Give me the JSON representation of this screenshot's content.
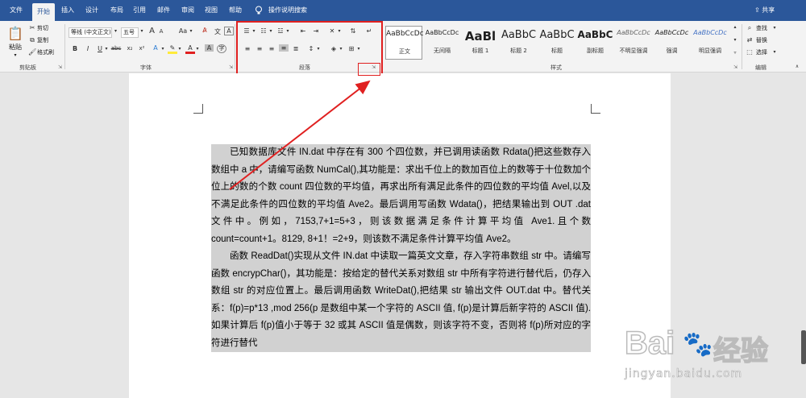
{
  "tabs": [
    "文件",
    "开始",
    "插入",
    "设计",
    "布局",
    "引用",
    "邮件",
    "审阅",
    "视图",
    "帮助"
  ],
  "active_tab": "开始",
  "tell_me": "操作说明搜索",
  "share": "共享",
  "clipboard": {
    "paste": "粘贴",
    "cut": "剪切",
    "copy": "复制",
    "format_painter": "格式刷",
    "group": "剪贴板"
  },
  "font": {
    "name": "等线 (中文正文)",
    "size": "五号",
    "group": "字体",
    "grow": "A",
    "shrink": "A",
    "case": "Aa",
    "bold": "B",
    "italic": "I",
    "underline": "U",
    "strike": "abc",
    "sub": "x₂",
    "sup": "x²"
  },
  "paragraph": {
    "group": "段落"
  },
  "styles": {
    "group": "样式",
    "items": [
      {
        "preview": "AaBbCcDc",
        "name": "正文",
        "color": "#1f1f1f"
      },
      {
        "preview": "AaBbCcDc",
        "name": "无间隔",
        "color": "#1f1f1f"
      },
      {
        "preview": "AaBl",
        "name": "标题 1",
        "color": "#1f1f1f"
      },
      {
        "preview": "AaBbC",
        "name": "标题 2",
        "color": "#1f1f1f"
      },
      {
        "preview": "AaBbC",
        "name": "标题",
        "color": "#1f1f1f"
      },
      {
        "preview": "AaBbC",
        "name": "副标题",
        "color": "#1f1f1f"
      },
      {
        "preview": "AaBbCcDc",
        "name": "不明显强调",
        "color": "#666666"
      },
      {
        "preview": "AaBbCcDc",
        "name": "强调",
        "color": "#1f1f1f"
      },
      {
        "preview": "AaBbCcDc",
        "name": "明显强调",
        "color": "#4472c4"
      }
    ]
  },
  "editing": {
    "find": "查找",
    "replace": "替换",
    "select": "选择",
    "group": "编辑"
  },
  "document": {
    "paragraphs": [
      "已知数据库文件 IN.dat 中存在有 300 个四位数，并已调用读函数 Rdata()把这些数存入数组中 a 中，请编写函数 NumCal(),其功能是：求出千位上的数加百位上的数等于十位数加个位上的数的个数 count 四位数的平均值，再求出所有满足此条件的四位数的平均值 Avel,以及不满足此条件的四位数的平均值  Ave2。最后调用写函数  Wdata()，把结果输出到 OUT .dat  文件中。例如，7153,7+1=5+3，则该数据满足条件计算平均值  Ave1.且个数 count=count+1。8129,   8+1！=2+9，则该数不满足条件计算平均值 Ave2。",
      "函数 ReadDat()实现从文件 IN.dat 中读取一篇英文文章，存入字符串数组 str 中。请编写函数 encrypChar()，其功能是：按给定的替代关系对数组 str 中所有字符进行替代后，仍存入数组 str 的对应位置上。最后调用函数 WriteDat(),把结果 str 输出文件 OUT.dat 中。替代关系：f(p)=p*13 ,mod 256(p 是数组中某一个字符的 ASCII 值, f(p)是计算后新字符的 ASCII 值).如果计算后 f(p)值小于等于 32 或其 ASCII 值是偶数，则该字符不变，否则将 f(p)所对应的字符进行替代 "
    ]
  },
  "watermark": {
    "brand": "Bai",
    "brand2": "经验",
    "url": "jingyan.baidu.com"
  },
  "colors": {
    "ribbon_blue": "#2b579a",
    "highlight": "#e02020",
    "arrow": "#e02020",
    "selection": "#d1d1d1"
  }
}
